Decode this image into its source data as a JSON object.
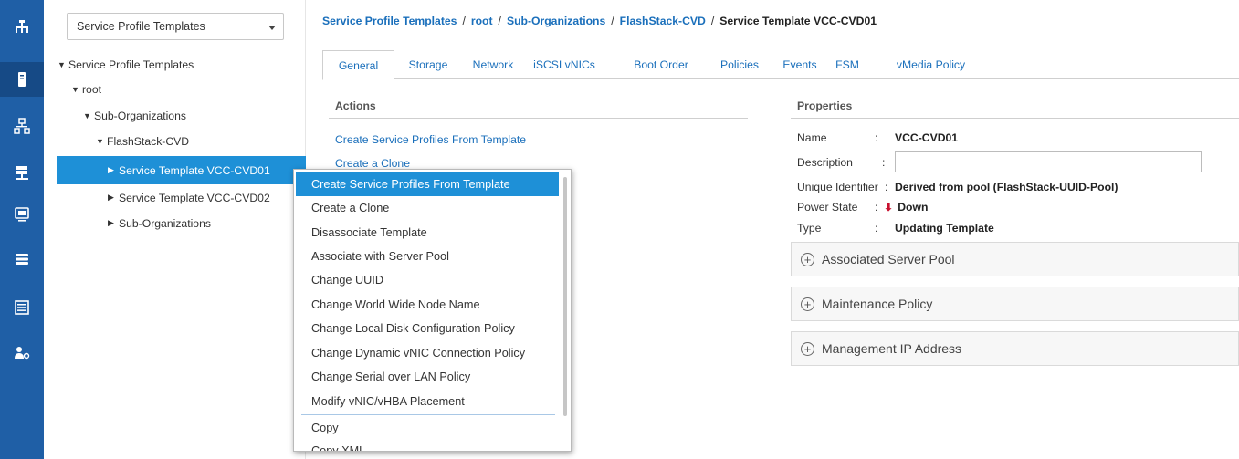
{
  "nav": {
    "filter_value": "Service Profile Templates",
    "tree": [
      {
        "label": "Service Profile Templates",
        "toggle": "▼"
      },
      {
        "label": "root",
        "toggle": "▼"
      },
      {
        "label": "Sub-Organizations",
        "toggle": "▼"
      },
      {
        "label": "FlashStack-CVD",
        "toggle": "▼"
      },
      {
        "label": "Service Template VCC-CVD01",
        "toggle": "▶"
      },
      {
        "label": "Service Template VCC-CVD02",
        "toggle": "▶"
      },
      {
        "label": "Sub-Organizations",
        "toggle": "▶"
      }
    ]
  },
  "rail_icons": [
    "network-icon",
    "server-icon",
    "lan-icon",
    "san-icon",
    "vm-icon",
    "storage-icon",
    "chassis-icon",
    "admin-icon"
  ],
  "breadcrumb": {
    "items": [
      "Service Profile Templates",
      "root",
      "Sub-Organizations",
      "FlashStack-CVD"
    ],
    "separator": "/",
    "current": "Service Template VCC-CVD01"
  },
  "tabs": [
    "General",
    "Storage",
    "Network",
    "iSCSI vNICs",
    "Boot Order",
    "Policies",
    "Events",
    "FSM",
    "vMedia Policy"
  ],
  "actions": {
    "title": "Actions",
    "links": [
      "Create Service Profiles From Template",
      "Create a Clone"
    ]
  },
  "properties": {
    "title": "Properties",
    "name_label": "Name",
    "name_value": "VCC-CVD01",
    "description_label": "Description",
    "description_value": "",
    "uuid_label": "Unique Identifier",
    "uuid_value": "Derived from pool (FlashStack-UUID-Pool)",
    "power_label": "Power State",
    "power_value": "Down",
    "power_arrow": "⬇",
    "type_label": "Type",
    "type_value": "Updating Template",
    "colon": ":"
  },
  "sections": [
    "Associated Server Pool",
    "Maintenance Policy",
    "Management IP Address"
  ],
  "context_menu": {
    "items": [
      "Create Service Profiles From Template",
      "Create a Clone",
      "Disassociate Template",
      "Associate with Server Pool",
      "Change UUID",
      "Change World Wide Node Name",
      "Change Local Disk Configuration Policy",
      "Change Dynamic vNIC Connection Policy",
      "Change Serial over LAN Policy",
      "Modify vNIC/vHBA Placement",
      "Copy",
      "Copy XML"
    ]
  },
  "colors": {
    "rail": "#1f5fa6",
    "accent": "#1e90d7",
    "link": "#1a6fbb",
    "power_down": "#c8102e"
  }
}
